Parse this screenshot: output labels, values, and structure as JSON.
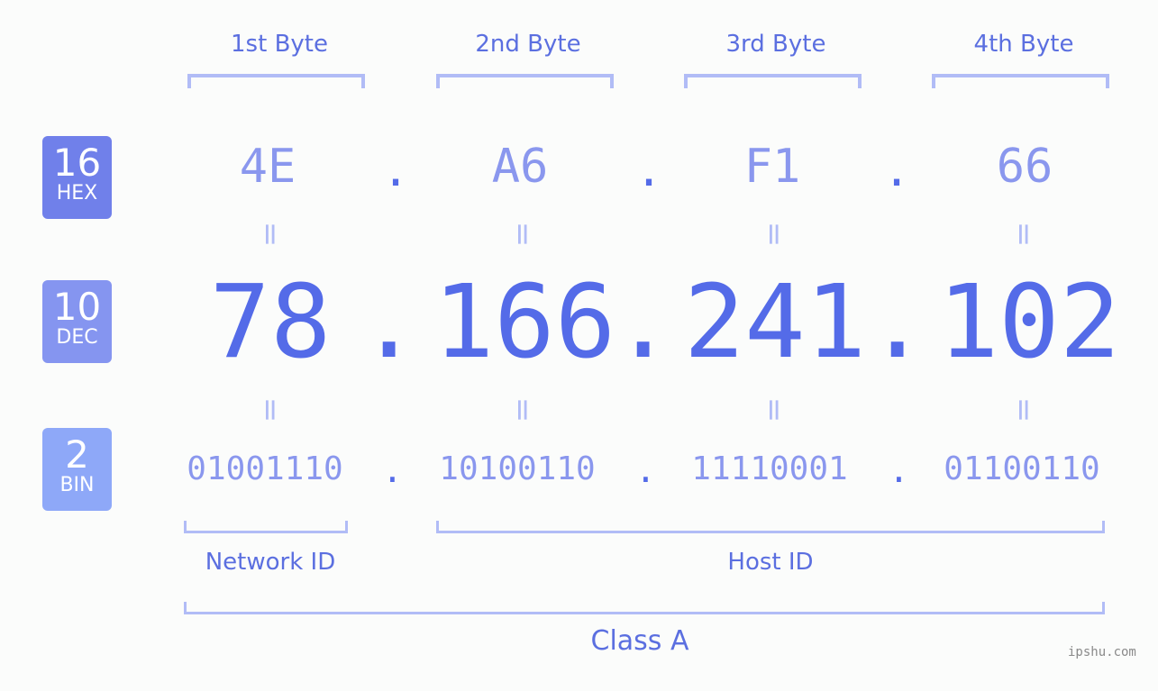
{
  "badges": [
    {
      "num": "16",
      "label": "HEX",
      "color": "#7080ea"
    },
    {
      "num": "10",
      "label": "DEC",
      "color": "#8595f0"
    },
    {
      "num": "2",
      "label": "BIN",
      "color": "#8ea8f8"
    }
  ],
  "bytes": [
    {
      "header": "1st Byte",
      "hex": "4E",
      "dec": "78",
      "bin": "01001110"
    },
    {
      "header": "2nd Byte",
      "hex": "A6",
      "dec": "166",
      "bin": "10100110"
    },
    {
      "header": "3rd Byte",
      "hex": "F1",
      "dec": "241",
      "bin": "11110001"
    },
    {
      "header": "4th Byte",
      "hex": "66",
      "dec": "102",
      "bin": "01100110"
    }
  ],
  "separator": ".",
  "equals": "=",
  "labels": {
    "network_id": "Network ID",
    "host_id": "Host ID",
    "class": "Class A"
  },
  "watermark": "ipshu.com",
  "colors": {
    "accent": "#546be8",
    "light": "#8a97ee",
    "bracket": "#b1bcf6"
  }
}
